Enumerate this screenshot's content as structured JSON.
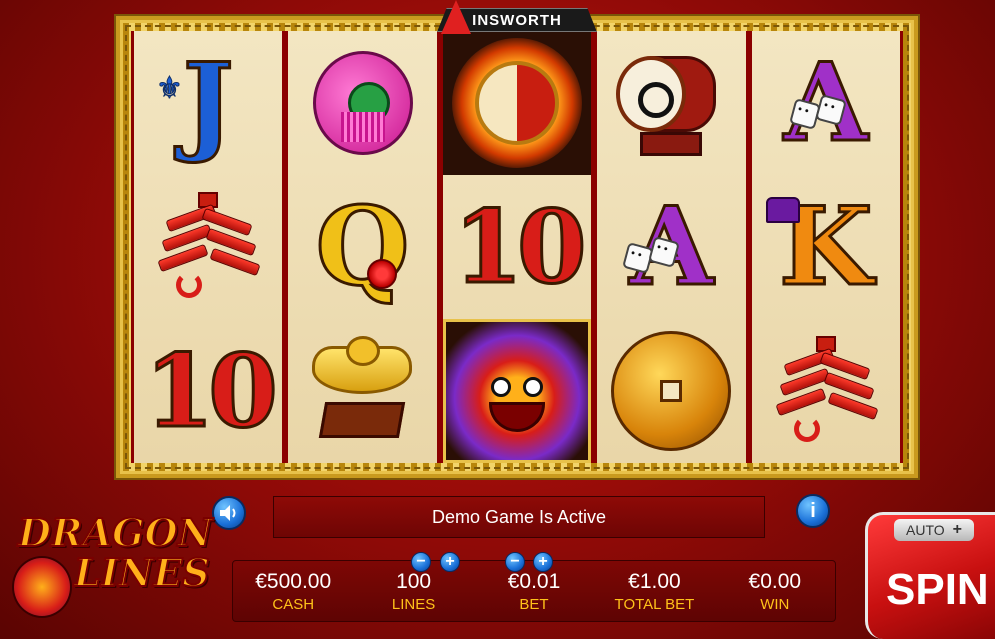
{
  "brand": {
    "name": "INSWORTH",
    "mark": "A"
  },
  "reels": [
    [
      "J",
      "lantern",
      "firecracker"
    ],
    [
      "lantern",
      "Q",
      "ingot"
    ],
    [
      "yin-yang",
      "10",
      "dragon"
    ],
    [
      "drum",
      "A",
      "coin"
    ],
    [
      "A",
      "K",
      "firecracker"
    ]
  ],
  "grid": {
    "r1": [
      "J",
      "",
      "",
      "",
      "A"
    ],
    "r2": [
      "",
      "Q",
      "10",
      "A",
      "K"
    ],
    "r3": [
      "10",
      "",
      "",
      "",
      ""
    ]
  },
  "message": "Demo Game Is Active",
  "meters": {
    "cash": {
      "value": "€500.00",
      "label": "CASH"
    },
    "lines": {
      "value": "100",
      "label": "LINES"
    },
    "bet": {
      "value": "€0.01",
      "label": "BET"
    },
    "total_bet": {
      "value": "€1.00",
      "label": "TOTAL BET"
    },
    "win": {
      "value": "€0.00",
      "label": "WIN"
    }
  },
  "buttons": {
    "spin": "SPIN",
    "auto": "AUTO",
    "plus": "+",
    "minus": "−",
    "info": "i"
  },
  "logo": {
    "line1": "DRAGON",
    "line2": "LINES"
  }
}
